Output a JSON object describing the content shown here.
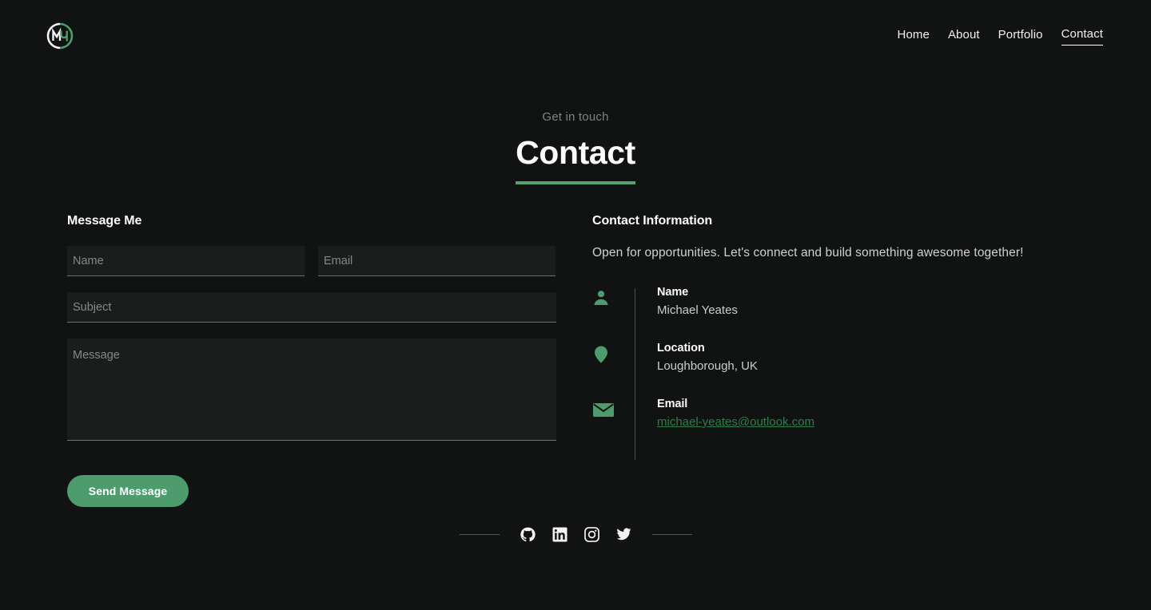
{
  "theme": {
    "background": "#111212",
    "accent_green": "#4e9c6d",
    "rule_green": "#57a172",
    "link_green": "#2f7d4c",
    "text_primary": "#fbfbfb",
    "text_muted": "#cfd2d1",
    "placeholder": "#85898a",
    "field_background": "#1b1d1c"
  },
  "header": {
    "logo": {
      "icon": "my-monogram-logo",
      "letters_left": "M",
      "letters_right": "Y"
    },
    "nav": [
      {
        "label": "Home",
        "active": false
      },
      {
        "label": "About",
        "active": false
      },
      {
        "label": "Portfolio",
        "active": false
      },
      {
        "label": "Contact",
        "active": true
      }
    ]
  },
  "hero": {
    "eyebrow": "Get in touch",
    "title": "Contact"
  },
  "form": {
    "heading": "Message Me",
    "fields": [
      {
        "name": "name",
        "placeholder": "Name",
        "value": ""
      },
      {
        "name": "email",
        "placeholder": "Email",
        "value": ""
      },
      {
        "name": "subject",
        "placeholder": "Subject",
        "value": ""
      },
      {
        "name": "message",
        "placeholder": "Message",
        "value": ""
      }
    ],
    "submit_label": "Send Message"
  },
  "contact_info": {
    "heading": "Contact Information",
    "intro": "Open for opportunities. Let's connect and build something awesome together!",
    "items": [
      {
        "icon": "person-icon",
        "label": "Name",
        "value": "Michael Yeates",
        "is_link": false
      },
      {
        "icon": "location-pin-icon",
        "label": "Location",
        "value": "Loughborough, UK",
        "is_link": false
      },
      {
        "icon": "envelope-icon",
        "label": "Email",
        "value": "michael-yeates@outlook.com",
        "is_link": true
      }
    ]
  },
  "footer": {
    "socials": [
      {
        "name": "github",
        "label": "GitHub"
      },
      {
        "name": "linkedin",
        "label": "LinkedIn"
      },
      {
        "name": "instagram",
        "label": "Instagram"
      },
      {
        "name": "twitter",
        "label": "Twitter"
      }
    ]
  }
}
